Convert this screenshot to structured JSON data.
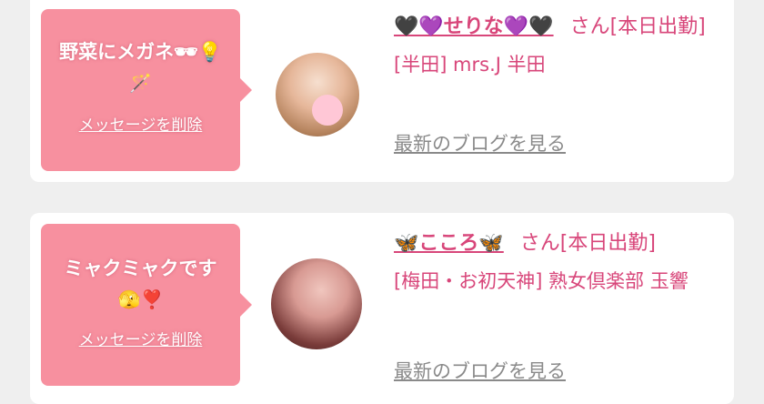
{
  "cards": [
    {
      "message": "野菜にメガネ🕶💡",
      "message_extra": "🪄",
      "delete_label": "メッセージを削除",
      "name": "🖤💜せりな💜🖤",
      "san_label": "さん[本日出勤]",
      "shop": "[半田] mrs.J 半田",
      "blog_label": "最新のブログを見る"
    },
    {
      "message": "ミャクミャクです",
      "message_extra": "🫣❣️",
      "delete_label": "メッセージを削除",
      "name": "🦋こころ🦋",
      "san_label": "さん[本日出勤]",
      "shop": "[梅田・お初天神] 熟女倶楽部 玉響",
      "blog_label": "最新のブログを見る"
    }
  ],
  "colors": {
    "bubble": "#f7909f",
    "accent_text": "#d8467a",
    "link_gray": "#8a8a8a",
    "background": "#efefef"
  }
}
